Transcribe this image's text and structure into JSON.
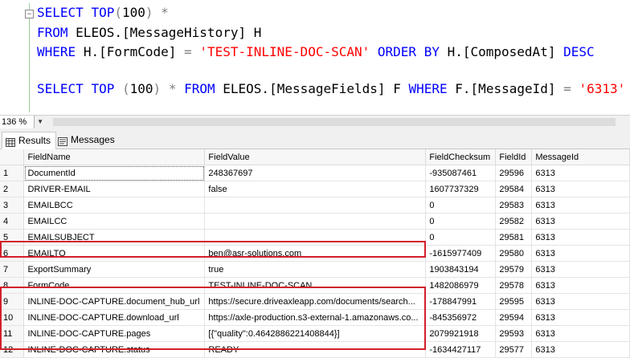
{
  "editor": {
    "line1": {
      "kw1": "SELECT",
      "kw2": "TOP",
      "paren_open": "(",
      "num": "100",
      "paren_close": ")",
      "star": "*"
    },
    "line2": {
      "kw": "FROM",
      "obj": "ELEOS.[MessageHistory] H"
    },
    "line3": {
      "kw1": "WHERE",
      "col": "H.[FormCode]",
      "eq": "=",
      "str": "'TEST-INLINE-DOC-SCAN'",
      "kw2": "ORDER BY",
      "col2": "H.[ComposedAt]",
      "kw3": "DESC"
    },
    "line5": {
      "kw1": "SELECT",
      "kw2": "TOP",
      "paren_open": "(",
      "num": "100",
      "paren_close": ")",
      "star": "*",
      "kw3": "FROM",
      "obj": "ELEOS.[MessageFields] F",
      "kw4": "WHERE",
      "col": "F.[MessageId]",
      "eq": "=",
      "str": "'6313'"
    }
  },
  "statusbar": {
    "zoom": "136 %"
  },
  "tabs": [
    {
      "label": "Results",
      "icon": "grid-icon",
      "active": true
    },
    {
      "label": "Messages",
      "icon": "messages-icon",
      "active": false
    }
  ],
  "grid": {
    "columns": [
      "",
      "FieldName",
      "FieldValue",
      "FieldChecksum",
      "FieldId",
      "MessageId"
    ],
    "rows": [
      [
        "1",
        "DocumentId",
        "248367697",
        "-935087461",
        "29596",
        "6313"
      ],
      [
        "2",
        "DRIVER-EMAIL",
        "false",
        "1607737329",
        "29584",
        "6313"
      ],
      [
        "3",
        "EMAILBCC",
        "",
        "0",
        "29583",
        "6313"
      ],
      [
        "4",
        "EMAILCC",
        "",
        "0",
        "29582",
        "6313"
      ],
      [
        "5",
        "EMAILSUBJECT",
        "",
        "0",
        "29581",
        "6313"
      ],
      [
        "6",
        "EMAILTO",
        "ben@asr-solutions.com",
        "-1615977409",
        "29580",
        "6313"
      ],
      [
        "7",
        "ExportSummary",
        "true",
        "1903843194",
        "29579",
        "6313"
      ],
      [
        "8",
        "FormCode",
        "TEST-INLINE-DOC-SCAN",
        "1482086979",
        "29578",
        "6313"
      ],
      [
        "9",
        "INLINE-DOC-CAPTURE.document_hub_url",
        "https://secure.driveaxleapp.com/documents/search...",
        "-178847991",
        "29595",
        "6313"
      ],
      [
        "10",
        "INLINE-DOC-CAPTURE.download_url",
        "https://axle-production.s3-external-1.amazonaws.co...",
        "-845356972",
        "29594",
        "6313"
      ],
      [
        "11",
        "INLINE-DOC-CAPTURE.pages",
        "[{\"quality\":0.4642886221408844}]",
        "2079921918",
        "29593",
        "6313"
      ],
      [
        "12",
        "INLINE-DOC-CAPTURE.status",
        "READY",
        "-1634427117",
        "29577",
        "6313"
      ]
    ]
  },
  "colors": {
    "highlight": "#d31f2a",
    "keyword": "#0000ff",
    "string": "#ff0000",
    "function": "#ff00ff"
  }
}
